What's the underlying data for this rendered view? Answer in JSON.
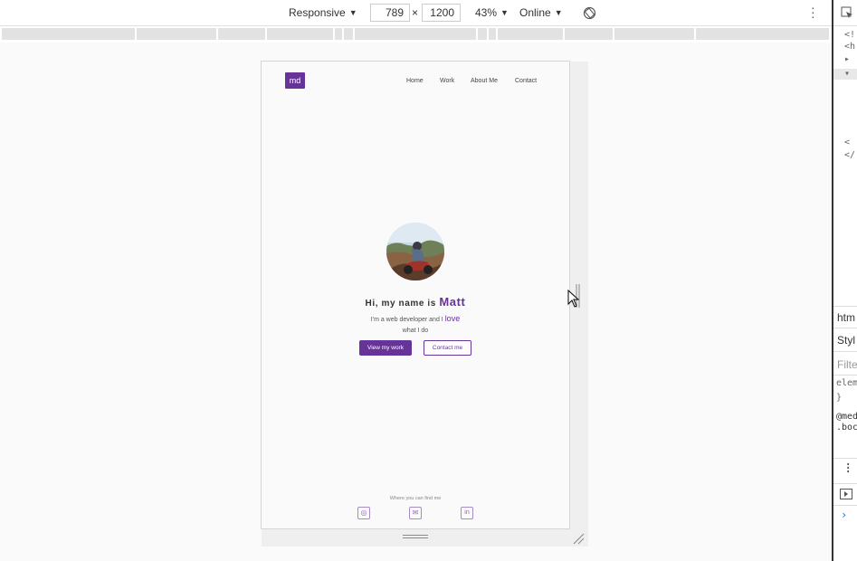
{
  "toolbar": {
    "device": "Responsive",
    "width": "789",
    "times": "×",
    "height": "1200",
    "zoom": "43%",
    "throttle": "Online",
    "rotate_icon": "rotate-icon",
    "more_icon": "kebab-menu-icon"
  },
  "site": {
    "logo": "md",
    "nav": [
      "Home",
      "Work",
      "About Me",
      "Contact"
    ],
    "greeting_prefix": "Hi, my name is",
    "name": "Matt",
    "tagline_prefix": "I'm a web developer and I",
    "tagline_love": "love",
    "tagline_suffix": "what I do",
    "primary_button": "View my work",
    "secondary_button": "Contact me",
    "find_me": "Where you can find me",
    "social": [
      "github-icon",
      "mail-icon",
      "linkedin-icon"
    ],
    "social_glyphs": [
      "◎",
      "✉",
      "in"
    ],
    "accent_color": "#663399"
  },
  "devtools": {
    "code_lines": [
      "<!",
      "<h",
      "▸",
      "▾",
      "<",
      "</"
    ],
    "breadcrumb": "htm",
    "tab_styles": "Styl",
    "filter": "Filte",
    "element_style": "elem",
    "close_brace": "}",
    "media": "@med",
    "selector": ".boc"
  }
}
